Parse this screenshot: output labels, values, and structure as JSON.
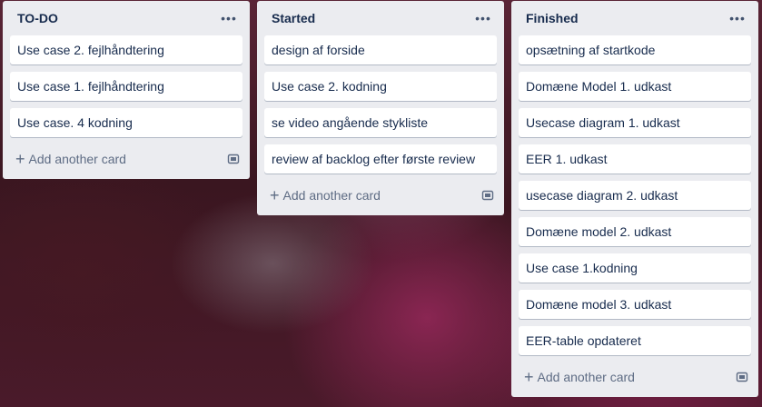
{
  "lists": [
    {
      "title": "TO-DO",
      "cards": [
        "Use case 2. fejlhåndtering",
        "Use case 1. fejlhåndtering",
        "Use case. 4 kodning"
      ],
      "add_label": "Add another card"
    },
    {
      "title": "Started",
      "cards": [
        "design af forside",
        "Use case 2. kodning",
        "se video angående stykliste",
        "review af backlog efter første review"
      ],
      "add_label": "Add another card"
    },
    {
      "title": "Finished",
      "cards": [
        "opsætning af startkode",
        "Domæne Model 1. udkast",
        "Usecase diagram 1. udkast",
        "EER 1. udkast",
        "usecase diagram 2. udkast",
        "Domæne model 2. udkast",
        "Use case 1.kodning",
        "Domæne model 3. udkast",
        "EER-table opdateret"
      ],
      "add_label": "Add another card"
    }
  ],
  "icons": {
    "more": "ellipsis-icon",
    "add": "plus-icon",
    "template": "card-template-icon"
  },
  "colors": {
    "list_bg": "#ebecf0",
    "card_bg": "#ffffff",
    "text": "#172b4d",
    "muted": "#5e6c84"
  }
}
